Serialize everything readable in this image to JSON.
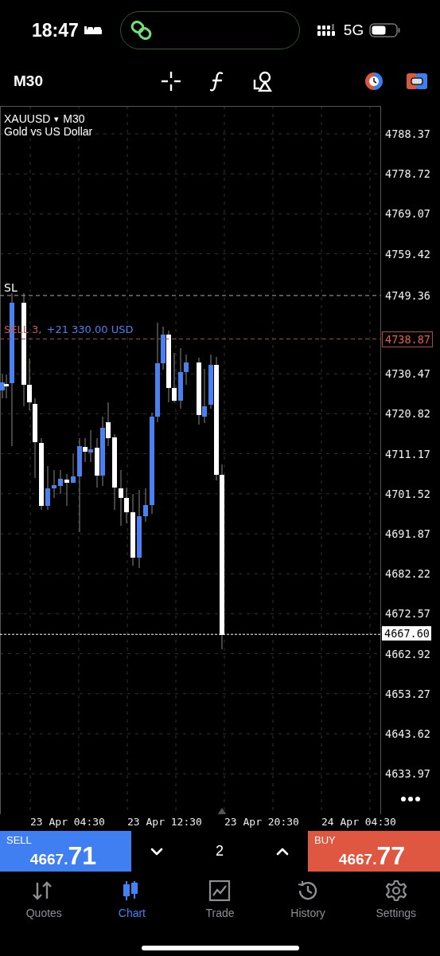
{
  "status_bar": {
    "time": "18:47",
    "network": "5G"
  },
  "toolbar": {
    "timeframe": "M30"
  },
  "chart": {
    "symbol": "XAUUSD",
    "symbol_menu": "▾",
    "symbol_timeframe": "M30",
    "description": "Gold vs US Dollar",
    "price_labels": [
      "4788.37",
      "4778.72",
      "4769.07",
      "4759.42",
      "4730.47",
      "4720.82",
      "4711.17",
      "4701.52",
      "4691.87",
      "4682.22",
      "4672.57",
      "4662.92",
      "4653.27",
      "4643.62",
      "4633.97"
    ],
    "stop_loss": {
      "label": "SL",
      "price": "4749.36"
    },
    "position": {
      "side": "SELL 3,",
      "profit": "+21 330.00 USD",
      "price": "4738.87"
    },
    "current_price": "4667.60",
    "time_labels": [
      "23 Apr 04:30",
      "23 Apr 12:30",
      "23 Apr 20:30",
      "24 Apr 04:30"
    ]
  },
  "trade_bar": {
    "sell": {
      "label": "SELL",
      "price": "4667.",
      "price_big": "71"
    },
    "volume": "2",
    "buy": {
      "label": "BUY",
      "price": "4667.",
      "price_big": "77"
    }
  },
  "tabs": [
    {
      "label": "Quotes",
      "selected": false
    },
    {
      "label": "Chart",
      "selected": true
    },
    {
      "label": "Trade",
      "selected": false
    },
    {
      "label": "History",
      "selected": false
    },
    {
      "label": "Settings",
      "selected": false
    }
  ]
}
